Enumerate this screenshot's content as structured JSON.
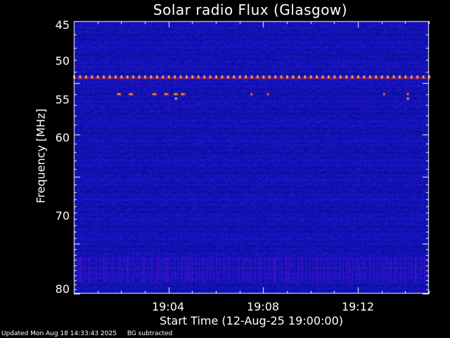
{
  "chart_data": {
    "type": "heatmap",
    "title": "Solar radio Flux (Glasgow)",
    "xlabel": "Start Time (12-Aug-25 19:00:00)",
    "ylabel": "Frequency [MHz]",
    "x_ticks": [
      "19:04",
      "19:08",
      "19:12"
    ],
    "x_tick_minutes": [
      4,
      8,
      12
    ],
    "xlim_minutes": [
      0,
      15
    ],
    "y_ticks": [
      45,
      50,
      55,
      60,
      70,
      80
    ],
    "ylim_mhz": [
      45,
      80
    ],
    "y_scale": "reciprocal",
    "background_color": "#1a18b4",
    "emission_bands": [
      {
        "frequency_mhz": 49.5,
        "type": "periodic-bursts",
        "period_minutes": 0.25
      },
      {
        "frequency_mhz": 50.9,
        "type": "intermittent-bursts",
        "minutes": [
          1.9,
          2.4,
          3.4,
          3.9,
          4.3,
          4.6,
          7.5,
          8.2,
          13.1,
          14.1
        ]
      },
      {
        "frequency_mhz": 74.5,
        "type": "faint-band"
      }
    ]
  },
  "footer": {
    "updated": "Updated Mon Aug 18 14:33:43 2025",
    "mode": "BG subtracted"
  }
}
